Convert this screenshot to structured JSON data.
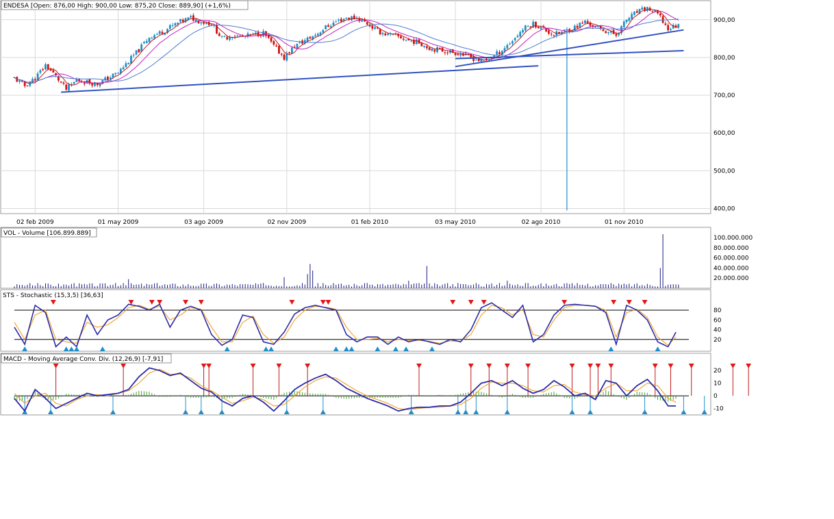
{
  "chart_data": [
    {
      "type": "candlestick",
      "title": "ENDESA [Open: 876,00  High: 900,00  Low: 875,20  Close: 889,90] (+1,6%)",
      "ohlc": {
        "open": 876.0,
        "high": 900.0,
        "low": 875.2,
        "close": 889.9,
        "change_pct": 1.6
      },
      "ylim": [
        390,
        945
      ],
      "y_ticks": [
        400,
        500,
        600,
        700,
        800,
        900
      ],
      "y_tick_labels": [
        "400,00",
        "500,00",
        "600,00",
        "700,00",
        "800,00",
        "900,00"
      ],
      "x_tick_labels": [
        "02 feb 2009",
        "01 may 2009",
        "03 ago 2009",
        "02 nov 2009",
        "01 feb 2010",
        "03 may 2010",
        "02 ago 2010",
        "01 nov 2010"
      ],
      "x_tick_index": [
        8,
        40,
        73,
        105,
        137,
        170,
        203,
        235
      ],
      "grid": true,
      "close_series": [
        {
          "i": 0,
          "v": 745
        },
        {
          "i": 4,
          "v": 725
        },
        {
          "i": 8,
          "v": 745
        },
        {
          "i": 12,
          "v": 780
        },
        {
          "i": 16,
          "v": 750
        },
        {
          "i": 20,
          "v": 715
        },
        {
          "i": 24,
          "v": 740
        },
        {
          "i": 28,
          "v": 735
        },
        {
          "i": 32,
          "v": 730
        },
        {
          "i": 36,
          "v": 745
        },
        {
          "i": 40,
          "v": 760
        },
        {
          "i": 44,
          "v": 790
        },
        {
          "i": 48,
          "v": 820
        },
        {
          "i": 52,
          "v": 855
        },
        {
          "i": 56,
          "v": 865
        },
        {
          "i": 60,
          "v": 880
        },
        {
          "i": 64,
          "v": 895
        },
        {
          "i": 68,
          "v": 905
        },
        {
          "i": 72,
          "v": 895
        },
        {
          "i": 76,
          "v": 890
        },
        {
          "i": 80,
          "v": 850
        },
        {
          "i": 84,
          "v": 858
        },
        {
          "i": 88,
          "v": 855
        },
        {
          "i": 92,
          "v": 860
        },
        {
          "i": 96,
          "v": 865
        },
        {
          "i": 100,
          "v": 830
        },
        {
          "i": 104,
          "v": 800
        },
        {
          "i": 108,
          "v": 830
        },
        {
          "i": 112,
          "v": 845
        },
        {
          "i": 116,
          "v": 860
        },
        {
          "i": 120,
          "v": 880
        },
        {
          "i": 124,
          "v": 895
        },
        {
          "i": 128,
          "v": 905
        },
        {
          "i": 132,
          "v": 905
        },
        {
          "i": 136,
          "v": 890
        },
        {
          "i": 140,
          "v": 870
        },
        {
          "i": 144,
          "v": 860
        },
        {
          "i": 148,
          "v": 855
        },
        {
          "i": 152,
          "v": 845
        },
        {
          "i": 156,
          "v": 840
        },
        {
          "i": 160,
          "v": 825
        },
        {
          "i": 164,
          "v": 820
        },
        {
          "i": 168,
          "v": 815
        },
        {
          "i": 172,
          "v": 810
        },
        {
          "i": 176,
          "v": 800
        },
        {
          "i": 180,
          "v": 790
        },
        {
          "i": 184,
          "v": 800
        },
        {
          "i": 188,
          "v": 820
        },
        {
          "i": 192,
          "v": 845
        },
        {
          "i": 196,
          "v": 875
        },
        {
          "i": 200,
          "v": 890
        },
        {
          "i": 204,
          "v": 875
        },
        {
          "i": 208,
          "v": 860
        },
        {
          "i": 212,
          "v": 870
        },
        {
          "i": 216,
          "v": 880
        },
        {
          "i": 220,
          "v": 895
        },
        {
          "i": 224,
          "v": 880
        },
        {
          "i": 228,
          "v": 870
        },
        {
          "i": 232,
          "v": 860
        },
        {
          "i": 236,
          "v": 900
        },
        {
          "i": 240,
          "v": 920
        },
        {
          "i": 244,
          "v": 930
        },
        {
          "i": 248,
          "v": 915
        },
        {
          "i": 252,
          "v": 875
        },
        {
          "i": 255,
          "v": 885
        }
      ],
      "spike": {
        "i": 213,
        "low": 395
      },
      "trendlines": [
        {
          "from": {
            "i": 18,
            "v": 708
          },
          "to": {
            "i": 202,
            "v": 778
          }
        },
        {
          "from": {
            "i": 170,
            "v": 776
          },
          "to": {
            "i": 258,
            "v": 873
          }
        },
        {
          "from": {
            "i": 170,
            "v": 797
          },
          "to": {
            "i": 258,
            "v": 818
          }
        }
      ]
    },
    {
      "type": "bar",
      "title": "VOL - Volume [106.899.889]",
      "ylim": [
        0,
        115000000
      ],
      "y_ticks": [
        20000000,
        40000000,
        60000000,
        80000000,
        100000000
      ],
      "y_tick_labels": [
        "20.000.000",
        "40.000.000",
        "60.000.000",
        "80.000.000",
        "100.000.000"
      ],
      "base_level": 7000000,
      "spikes": [
        {
          "i": 44,
          "v": 18000000
        },
        {
          "i": 104,
          "v": 22000000
        },
        {
          "i": 113,
          "v": 28000000
        },
        {
          "i": 114,
          "v": 48000000
        },
        {
          "i": 115,
          "v": 35000000
        },
        {
          "i": 159,
          "v": 44000000
        },
        {
          "i": 152,
          "v": 15000000
        },
        {
          "i": 190,
          "v": 15000000
        },
        {
          "i": 249,
          "v": 40000000
        },
        {
          "i": 250,
          "v": 106899889
        }
      ]
    },
    {
      "type": "line",
      "title": "STS - Stochastic (15,3,5) [36,63]",
      "ylim": [
        0,
        100
      ],
      "y_ticks": [
        20,
        40,
        60,
        80
      ],
      "y_tick_labels": [
        "20",
        "40",
        "60",
        "80"
      ],
      "levels": [
        20,
        80
      ],
      "series": [
        {
          "name": "",
          "color": "#2a2aa8",
          "x": [
            0,
            4,
            8,
            12,
            16,
            20,
            24,
            28,
            32,
            36,
            40,
            44,
            48,
            52,
            56,
            60,
            64,
            68,
            72,
            76,
            80,
            84,
            88,
            92,
            96,
            100,
            104,
            108,
            112,
            116,
            120,
            124,
            128,
            132,
            136,
            140,
            144,
            148,
            152,
            156,
            160,
            164,
            168,
            172,
            176,
            180,
            184,
            188,
            192,
            196,
            200,
            204,
            208,
            212,
            216,
            220,
            224,
            228,
            232,
            236,
            240,
            244,
            248,
            252,
            255
          ],
          "y": [
            45,
            10,
            90,
            75,
            5,
            25,
            5,
            70,
            30,
            60,
            70,
            92,
            88,
            80,
            92,
            45,
            80,
            88,
            80,
            30,
            8,
            20,
            70,
            65,
            15,
            10,
            35,
            72,
            85,
            90,
            85,
            80,
            30,
            15,
            25,
            25,
            10,
            25,
            15,
            20,
            15,
            10,
            20,
            15,
            40,
            85,
            95,
            80,
            65,
            90,
            15,
            30,
            70,
            90,
            92,
            90,
            88,
            75,
            10,
            90,
            80,
            60,
            15,
            5,
            35
          ]
        },
        {
          "name": "",
          "color": "#f0a020",
          "x": [
            0,
            4,
            8,
            12,
            16,
            20,
            24,
            28,
            32,
            36,
            40,
            44,
            48,
            52,
            56,
            60,
            64,
            68,
            72,
            76,
            80,
            84,
            88,
            92,
            96,
            100,
            104,
            108,
            112,
            116,
            120,
            124,
            128,
            132,
            136,
            140,
            144,
            148,
            152,
            156,
            160,
            164,
            168,
            172,
            176,
            180,
            184,
            188,
            192,
            196,
            200,
            204,
            208,
            212,
            216,
            220,
            224,
            228,
            232,
            236,
            240,
            244,
            248,
            252,
            255
          ],
          "y": [
            55,
            20,
            70,
            80,
            20,
            15,
            12,
            55,
            45,
            50,
            65,
            85,
            90,
            82,
            88,
            60,
            70,
            85,
            82,
            45,
            15,
            15,
            55,
            68,
            30,
            12,
            25,
            60,
            80,
            88,
            86,
            82,
            45,
            20,
            20,
            22,
            15,
            20,
            18,
            18,
            16,
            12,
            17,
            16,
            30,
            70,
            90,
            85,
            70,
            82,
            30,
            25,
            60,
            85,
            90,
            90,
            88,
            80,
            25,
            75,
            82,
            65,
            25,
            8,
            25
          ]
        }
      ],
      "sell_markers_at": [
        15,
        45,
        53,
        56,
        66,
        72,
        107,
        119,
        121,
        169,
        176,
        181,
        212,
        231,
        237,
        243
      ],
      "buy_markers_at": [
        4,
        20,
        22,
        24,
        34,
        82,
        97,
        99,
        124,
        128,
        130,
        140,
        147,
        151,
        161,
        230,
        248
      ]
    },
    {
      "type": "line",
      "title": "MACD - Moving Average Conv. Div. (12,26,9) [-7,91]",
      "ylim": [
        -14,
        26
      ],
      "y_ticks": [
        -10,
        0,
        10,
        20
      ],
      "y_tick_labels": [
        "-10",
        "0",
        "10",
        "20"
      ],
      "series": [
        {
          "name": "",
          "color": "#2a2aa8",
          "x": [
            0,
            4,
            8,
            12,
            16,
            20,
            24,
            28,
            32,
            36,
            40,
            44,
            48,
            52,
            56,
            60,
            64,
            68,
            72,
            76,
            80,
            84,
            88,
            92,
            96,
            100,
            104,
            108,
            112,
            116,
            120,
            124,
            128,
            132,
            136,
            140,
            144,
            148,
            152,
            156,
            160,
            164,
            168,
            172,
            176,
            180,
            184,
            188,
            192,
            196,
            200,
            204,
            208,
            212,
            216,
            220,
            224,
            228,
            232,
            236,
            240,
            244,
            248,
            252,
            255
          ],
          "y": [
            -2,
            -12,
            5,
            -2,
            -10,
            -6,
            -2,
            2,
            0,
            1,
            2,
            5,
            15,
            22,
            20,
            16,
            18,
            12,
            6,
            3,
            -4,
            -8,
            -2,
            0,
            -5,
            -12,
            -4,
            5,
            10,
            14,
            17,
            12,
            6,
            2,
            -2,
            -5,
            -8,
            -12,
            -10,
            -9,
            -9,
            -8,
            -8,
            -5,
            2,
            10,
            12,
            8,
            12,
            6,
            2,
            5,
            12,
            7,
            0,
            2,
            -3,
            12,
            10,
            0,
            8,
            13,
            4,
            -8,
            -8
          ]
        },
        {
          "name": "",
          "color": "#f0a020",
          "x": [
            0,
            4,
            8,
            12,
            16,
            20,
            24,
            28,
            32,
            36,
            40,
            44,
            48,
            52,
            56,
            60,
            64,
            68,
            72,
            76,
            80,
            84,
            88,
            92,
            96,
            100,
            104,
            108,
            112,
            116,
            120,
            124,
            128,
            132,
            136,
            140,
            144,
            148,
            152,
            156,
            160,
            164,
            168,
            172,
            176,
            180,
            184,
            188,
            192,
            196,
            200,
            204,
            208,
            212,
            216,
            220,
            224,
            228,
            232,
            236,
            240,
            244,
            248,
            252,
            255
          ],
          "y": [
            2,
            -6,
            0,
            2,
            -6,
            -8,
            -3,
            0,
            1,
            0,
            2,
            4,
            10,
            18,
            21,
            17,
            17,
            14,
            8,
            4,
            -1,
            -6,
            -4,
            -1,
            -3,
            -8,
            -7,
            0,
            7,
            12,
            15,
            14,
            9,
            4,
            0,
            -3,
            -6,
            -10,
            -11,
            -10,
            -9,
            -9,
            -8,
            -7,
            -2,
            6,
            11,
            10,
            10,
            8,
            4,
            3,
            8,
            9,
            3,
            1,
            0,
            6,
            10,
            4,
            4,
            10,
            8,
            -2,
            -5
          ]
        }
      ],
      "sell_markers_at": [
        16,
        42,
        73,
        75,
        92,
        102,
        113,
        156,
        176,
        183,
        190,
        198,
        215,
        222,
        225,
        230,
        247,
        253,
        261,
        277,
        283
      ],
      "buy_markers_at": [
        4,
        14,
        38,
        66,
        72,
        80,
        105,
        119,
        153,
        171,
        174,
        178,
        190,
        215,
        222,
        243,
        258,
        266
      ]
    }
  ]
}
